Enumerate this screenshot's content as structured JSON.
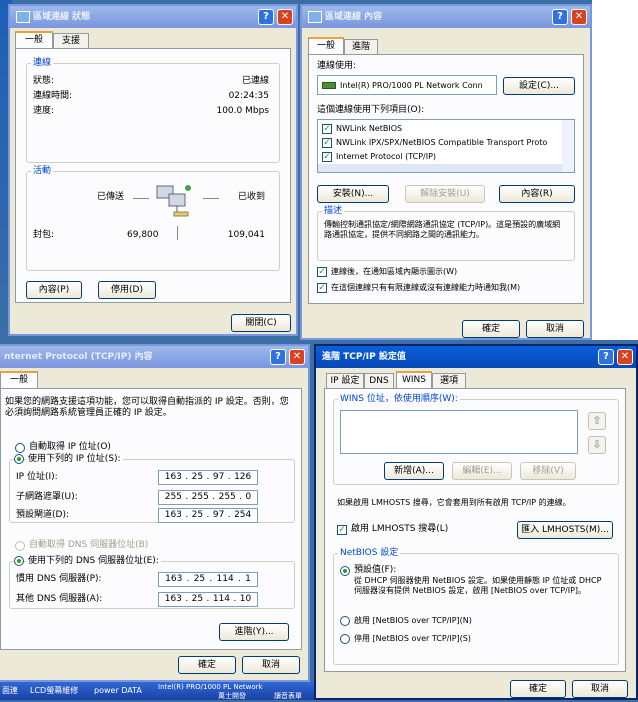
{
  "status_window": {
    "title": "區域連線 狀態",
    "tabs": [
      "一般",
      "支援"
    ],
    "connection_group": "連線",
    "rows": [
      {
        "label": "狀態:",
        "value": "已連線"
      },
      {
        "label": "連線時間:",
        "value": "02:24:35"
      },
      {
        "label": "速度:",
        "value": "100.0 Mbps"
      }
    ],
    "activity_group": "活動",
    "sent_label": "已傳送",
    "received_label": "已收到",
    "packets_label": "封包:",
    "packets_sent": "69,800",
    "packets_received": "109,041",
    "properties_button": "內容(P)",
    "disable_button": "停用(D)",
    "close_button": "關閉(C)"
  },
  "properties_window": {
    "title": "區域連線 內容",
    "tabs": [
      "一般",
      "進階"
    ],
    "connect_using_label": "連線使用:",
    "adapter_name": "Intel(R) PRO/1000 PL Network Conn",
    "configure_button": "設定(C)...",
    "items_label": "這個連線使用下列項目(O):",
    "items": [
      "NWLink NetBIOS",
      "NWLink IPX/SPX/NetBIOS Compatible Transport Proto",
      "Internet Protocol (TCP/IP)"
    ],
    "install_button": "安裝(N)...",
    "uninstall_button": "解除安裝(U)",
    "properties_button": "內容(R)",
    "description_title": "描述",
    "description_text": "傳輸控制通訊協定/網際網路通訊協定 (TCP/IP)。這是預設的廣域網路通訊協定，提供不同網路之間的通訊能力。",
    "show_icon_label": "連線後，在通知區域內顯示圖示(W)",
    "notify_label": "在這個連線只有有限連線或沒有連線能力時通知我(M)",
    "ok_button": "確定",
    "cancel_button": "取消"
  },
  "tcpip_window": {
    "title": "nternet Protocol (TCP/IP) 內容",
    "tab": "一般",
    "intro": "如果您的網路支援這項功能，您可以取得自動指派的 IP 設定。否則，您必須詢問網路系統管理員正確的 IP 設定。",
    "auto_ip": "自動取得 IP 位址(O)",
    "use_ip": "使用下列的 IP 位址(S):",
    "ip_label": "IP 位址(I):",
    "ip_value": [
      "163",
      "25",
      "97",
      "126"
    ],
    "mask_label": "子網路遮罩(U):",
    "mask_value": [
      "255",
      "255",
      "255",
      "0"
    ],
    "gateway_label": "預設閘道(D):",
    "gateway_value": [
      "163",
      "25",
      "97",
      "254"
    ],
    "auto_dns": "自動取得 DNS 伺服器位址(B)",
    "use_dns": "使用下列的 DNS 伺服器位址(E):",
    "pref_dns_label": "慣用 DNS 伺服器(P):",
    "pref_dns_value": [
      "163",
      "25",
      "114",
      "1"
    ],
    "alt_dns_label": "其他 DNS 伺服器(A):",
    "alt_dns_value": [
      "163",
      "25",
      "114",
      "10"
    ],
    "advanced_button": "進階(Y)...",
    "ok_button": "確定",
    "cancel_button": "取消"
  },
  "advanced_window": {
    "title": "進階 TCP/IP 設定值",
    "tabs": [
      "IP 設定",
      "DNS",
      "WINS",
      "選項"
    ],
    "wins_group": "WINS 位址，依使用順序(W):",
    "add_button": "新增(A)...",
    "edit_button": "編輯(E)...",
    "remove_button": "移除(V)",
    "lmhosts_note": "如果啟用 LMHOSTS 搜尋，它會套用到所有啟用 TCP/IP 的連線。",
    "lmhosts_check": "啟用 LMHOSTS 搜尋(L)",
    "import_button": "匯入 LMHOSTS(M)...",
    "netbios_group": "NetBIOS 設定",
    "default_option": "預設值(F):",
    "default_desc": "從 DHCP 伺服器使用 NetBIOS 設定。如果使用靜態 IP 位址或 DHCP 伺服器沒有提供 NetBIOS 設定，啟用 [NetBIOS over TCP/IP]。",
    "enable_option": "啟用 [NetBIOS over TCP/IP](N)",
    "disable_option": "停用 [NetBIOS over TCP/IP](S)",
    "ok_button": "確定",
    "cancel_button": "取消"
  },
  "taskbar": {
    "items": [
      "面連",
      "LCD螢幕維修",
      "power DATA",
      "Intel(R) PRO/1000 PL Network",
      "萬士開發",
      "讀音表單"
    ]
  },
  "colors": {
    "desktop": "#3a6ea5",
    "active_title": "#0a5fd8",
    "dialog_bg": "#ece9d8"
  }
}
